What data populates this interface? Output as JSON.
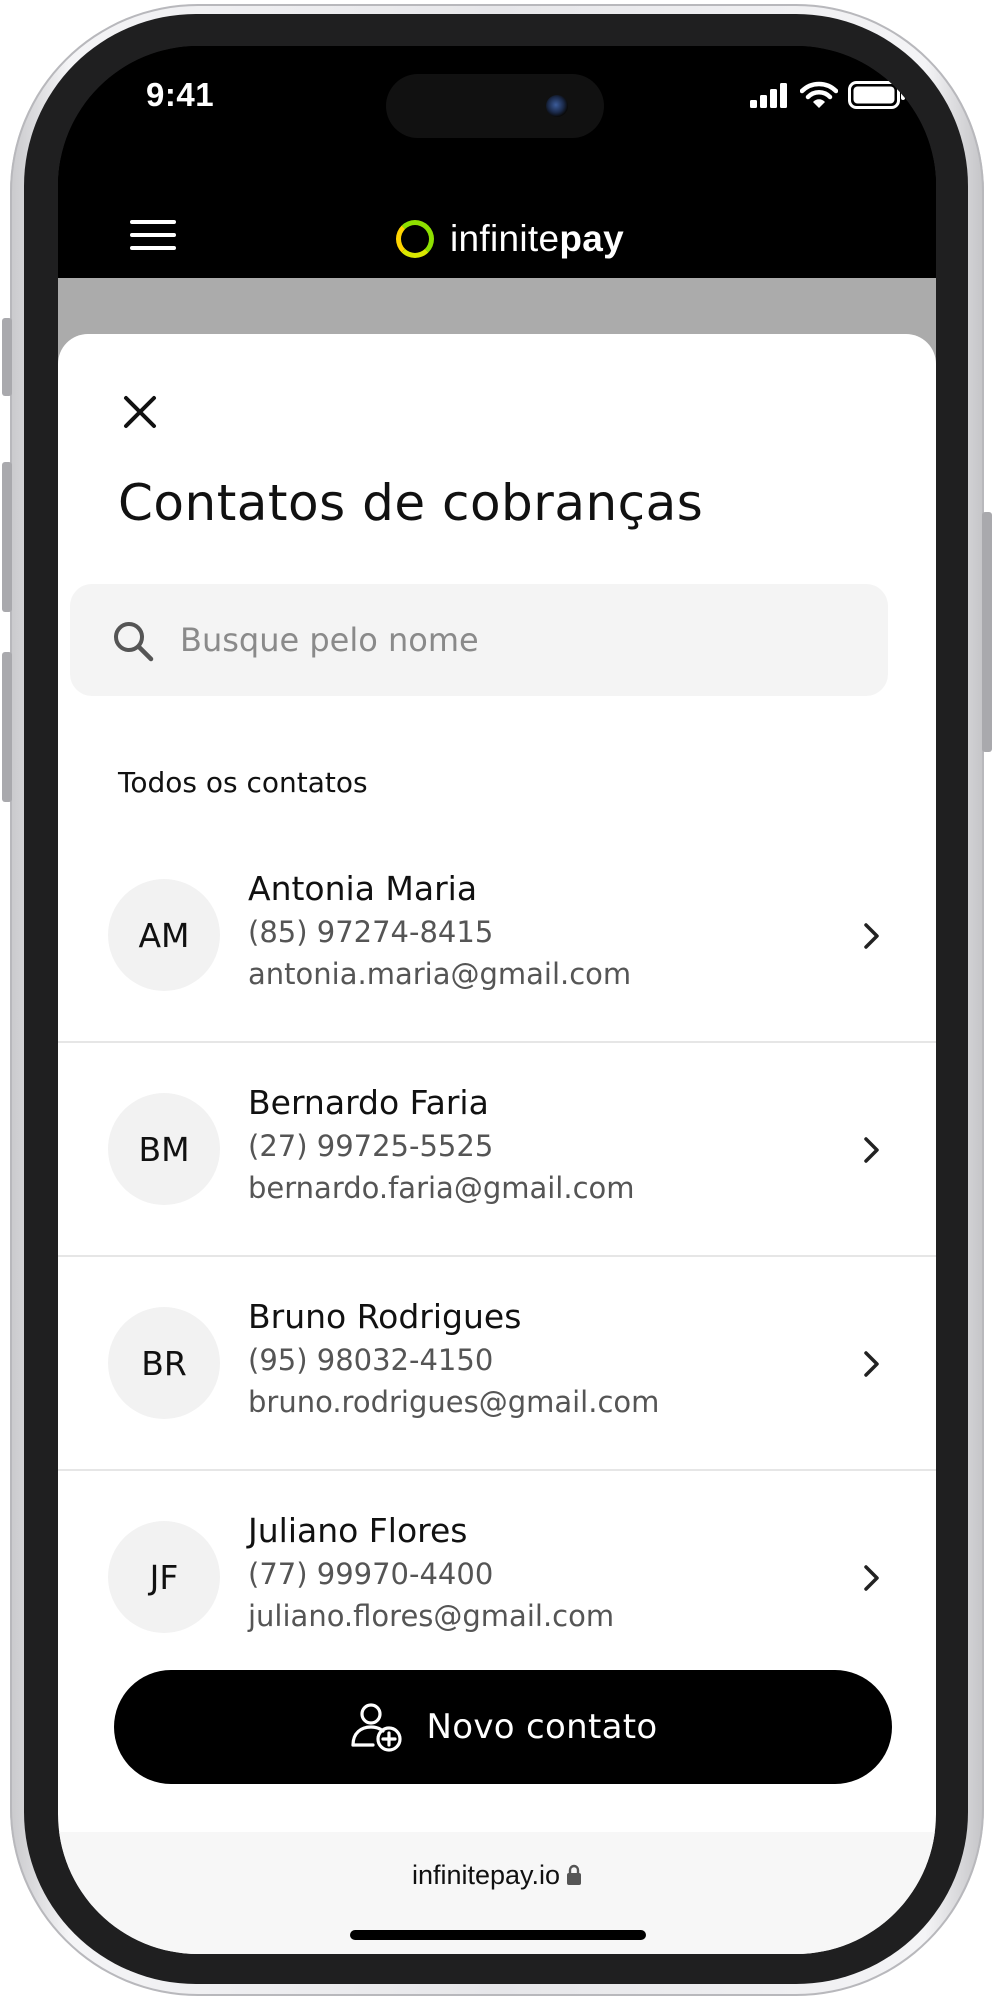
{
  "status_bar": {
    "time": "9:41"
  },
  "header": {
    "brand_light": "infinite",
    "brand_bold": "pay"
  },
  "sheet": {
    "title": "Contatos de cobranças",
    "search": {
      "placeholder": "Busque pelo nome",
      "value": ""
    },
    "section_label": "Todos os contatos",
    "contacts": [
      {
        "initials": "AM",
        "name": "Antonia Maria",
        "phone": "(85) 97274-8415",
        "email": "antonia.maria@gmail.com"
      },
      {
        "initials": "BM",
        "name": "Bernardo Faria",
        "phone": "(27) 99725-5525",
        "email": "bernardo.faria@gmail.com"
      },
      {
        "initials": "BR",
        "name": "Bruno Rodrigues",
        "phone": "(95) 98032-4150",
        "email": "bruno.rodrigues@gmail.com"
      },
      {
        "initials": "JF",
        "name": "Juliano Flores",
        "phone": "(77) 99970-4400",
        "email": "juliano.flores@gmail.com"
      }
    ],
    "new_contact_label": "Novo contato"
  },
  "browser": {
    "url": "infinitepay.io"
  },
  "icons": {
    "menu": "hamburger-menu-icon",
    "close": "close-icon",
    "search": "search-icon",
    "chevron": "chevron-right-icon",
    "add_contact": "add-user-icon",
    "lock": "lock-icon"
  },
  "colors": {
    "brand_green": "#8ee000",
    "brand_yellow": "#ffd400",
    "primary_button": "#000000"
  }
}
